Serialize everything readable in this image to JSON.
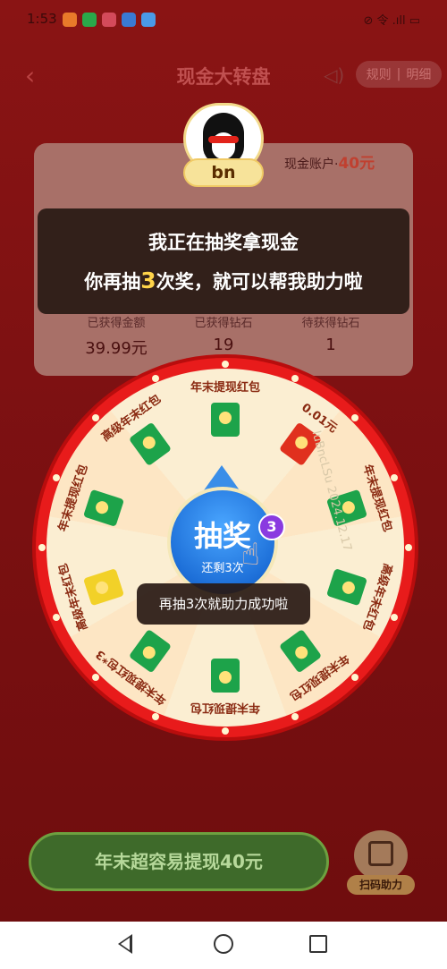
{
  "status_bar": {
    "time": "1:53",
    "signal": "⊘ 令 .ıll ▭"
  },
  "header": {
    "title": "现金大转盘",
    "back_icon": "chevron-left-icon",
    "rules": "规则",
    "details": "明细"
  },
  "account": {
    "label": "现金账户·",
    "amount": "40元"
  },
  "stats": [
    {
      "label": "已获得金额",
      "value": "39.99元"
    },
    {
      "label": "已获得钻石",
      "value": "19"
    },
    {
      "label": "待获得钻石",
      "value": "1"
    }
  ],
  "user": {
    "name": "bn"
  },
  "bubble": {
    "line1": "我正在抽奖拿现金",
    "line2_prefix": "你再抽",
    "line2_count": "3",
    "line2_middle": "次奖",
    "line2_suffix": "，就可以帮我助力啦"
  },
  "wheel": {
    "segments": [
      {
        "label": "年末提现红包",
        "envelope": "green"
      },
      {
        "label": "0.01元",
        "envelope": "red"
      },
      {
        "label": "年末提现红包",
        "envelope": "green"
      },
      {
        "label": "高级年末红包",
        "envelope": "green"
      },
      {
        "label": "年末提现红包",
        "envelope": "green"
      },
      {
        "label": "年末提现红包",
        "envelope": "green"
      },
      {
        "label": "年末提现红包*3",
        "envelope": "green"
      },
      {
        "label": "高级年末红包",
        "envelope": "yellow"
      },
      {
        "label": "年末提现红包",
        "envelope": "green"
      },
      {
        "label": "高级年末红包",
        "envelope": "green"
      }
    ],
    "watermark": "luBncLSu 2024.12.17"
  },
  "draw_button": {
    "label": "抽奖",
    "remaining": "还剩3次",
    "badge": "3"
  },
  "toast": "再抽3次就助力成功啦",
  "cashout_button": "年末超容易提现40元",
  "scan_help": "扫码助力",
  "colors": {
    "wheel_rim": "#e81b1b",
    "draw_button": "#1d6fd8",
    "cashout_button": "#3e6a2a"
  }
}
